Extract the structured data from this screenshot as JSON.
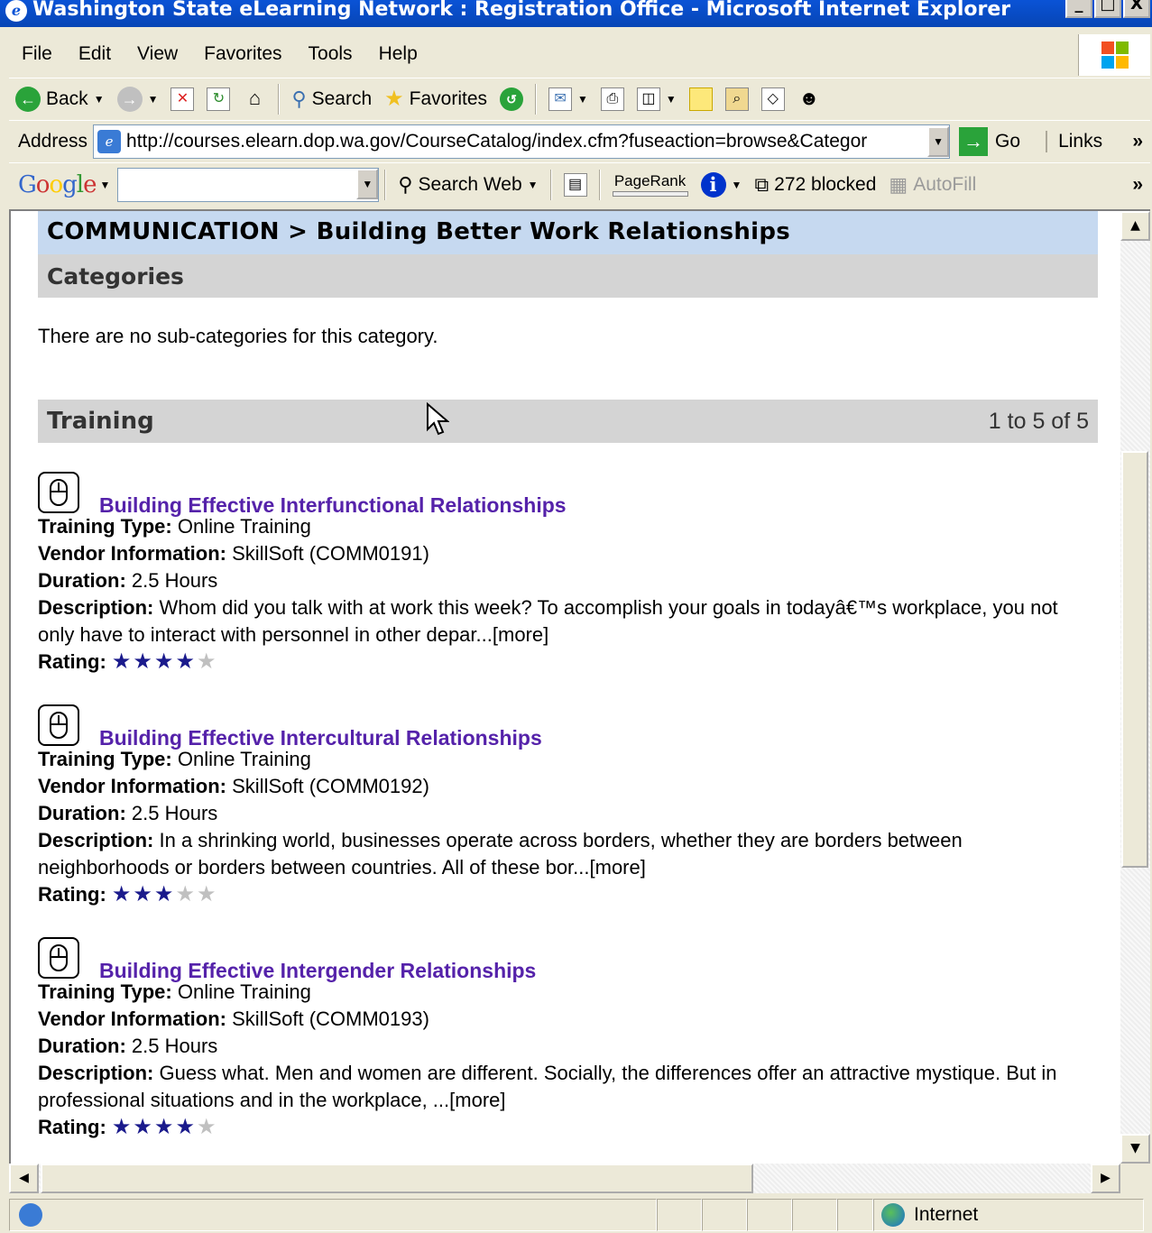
{
  "window": {
    "title": "Washington State eLearning Network : Registration Office - Microsoft Internet Explorer",
    "buttons": {
      "minimize": "_",
      "maximize": "□",
      "close": "X"
    }
  },
  "menu": [
    "File",
    "Edit",
    "View",
    "Favorites",
    "Tools",
    "Help"
  ],
  "toolbar": {
    "back_label": "Back",
    "search_label": "Search",
    "favorites_label": "Favorites"
  },
  "address": {
    "label": "Address",
    "url": "http://courses.elearn.dop.wa.gov/CourseCatalog/index.cfm?fuseaction=browse&Categor",
    "go_label": "Go",
    "links_label": "Links",
    "more_chevron": "»"
  },
  "googlebar": {
    "logo": "Google",
    "search_web_label": "Search Web",
    "pagerank_label": "PageRank",
    "blocked_label": "272 blocked",
    "autofill_label": "AutoFill",
    "more_chevron": "»"
  },
  "page": {
    "breadcrumb": "COMMUNICATION > Building Better Work Relationships",
    "categories_heading": "Categories",
    "no_subcategories": "There are no sub-categories for this category.",
    "training_heading": "Training",
    "training_count": "1 to 5 of 5",
    "labels": {
      "type": "Training Type:",
      "vendor": "Vendor Information:",
      "duration": "Duration:",
      "description": "Description:",
      "rating": "Rating:"
    },
    "more_link": "[more]",
    "courses": [
      {
        "title": "Building Effective Interfunctional Relationships",
        "type": "Online Training",
        "vendor": "SkillSoft (COMM0191)",
        "duration": "2.5 Hours",
        "description": "Whom did you talk with at work this week? To accomplish your goals in todayâ€™s workplace, you not only have to interact with personnel in other depar...",
        "rating": 4,
        "rating_max": 5
      },
      {
        "title": "Building Effective Intercultural Relationships",
        "type": "Online Training",
        "vendor": "SkillSoft (COMM0192)",
        "duration": "2.5 Hours",
        "description": "In a shrinking world, businesses operate across borders, whether they are borders between neighborhoods or borders between countries. All of these bor...",
        "rating": 3,
        "rating_max": 5
      },
      {
        "title": "Building Effective Intergender Relationships",
        "type": "Online Training",
        "vendor": "SkillSoft (COMM0193)",
        "duration": "2.5 Hours",
        "description": "Guess what. Men and women are different. Socially, the differences offer an attractive mystique. But in professional situations and in the workplace, ...",
        "rating": 4,
        "rating_max": 5
      }
    ]
  },
  "status": {
    "zone": "Internet"
  }
}
